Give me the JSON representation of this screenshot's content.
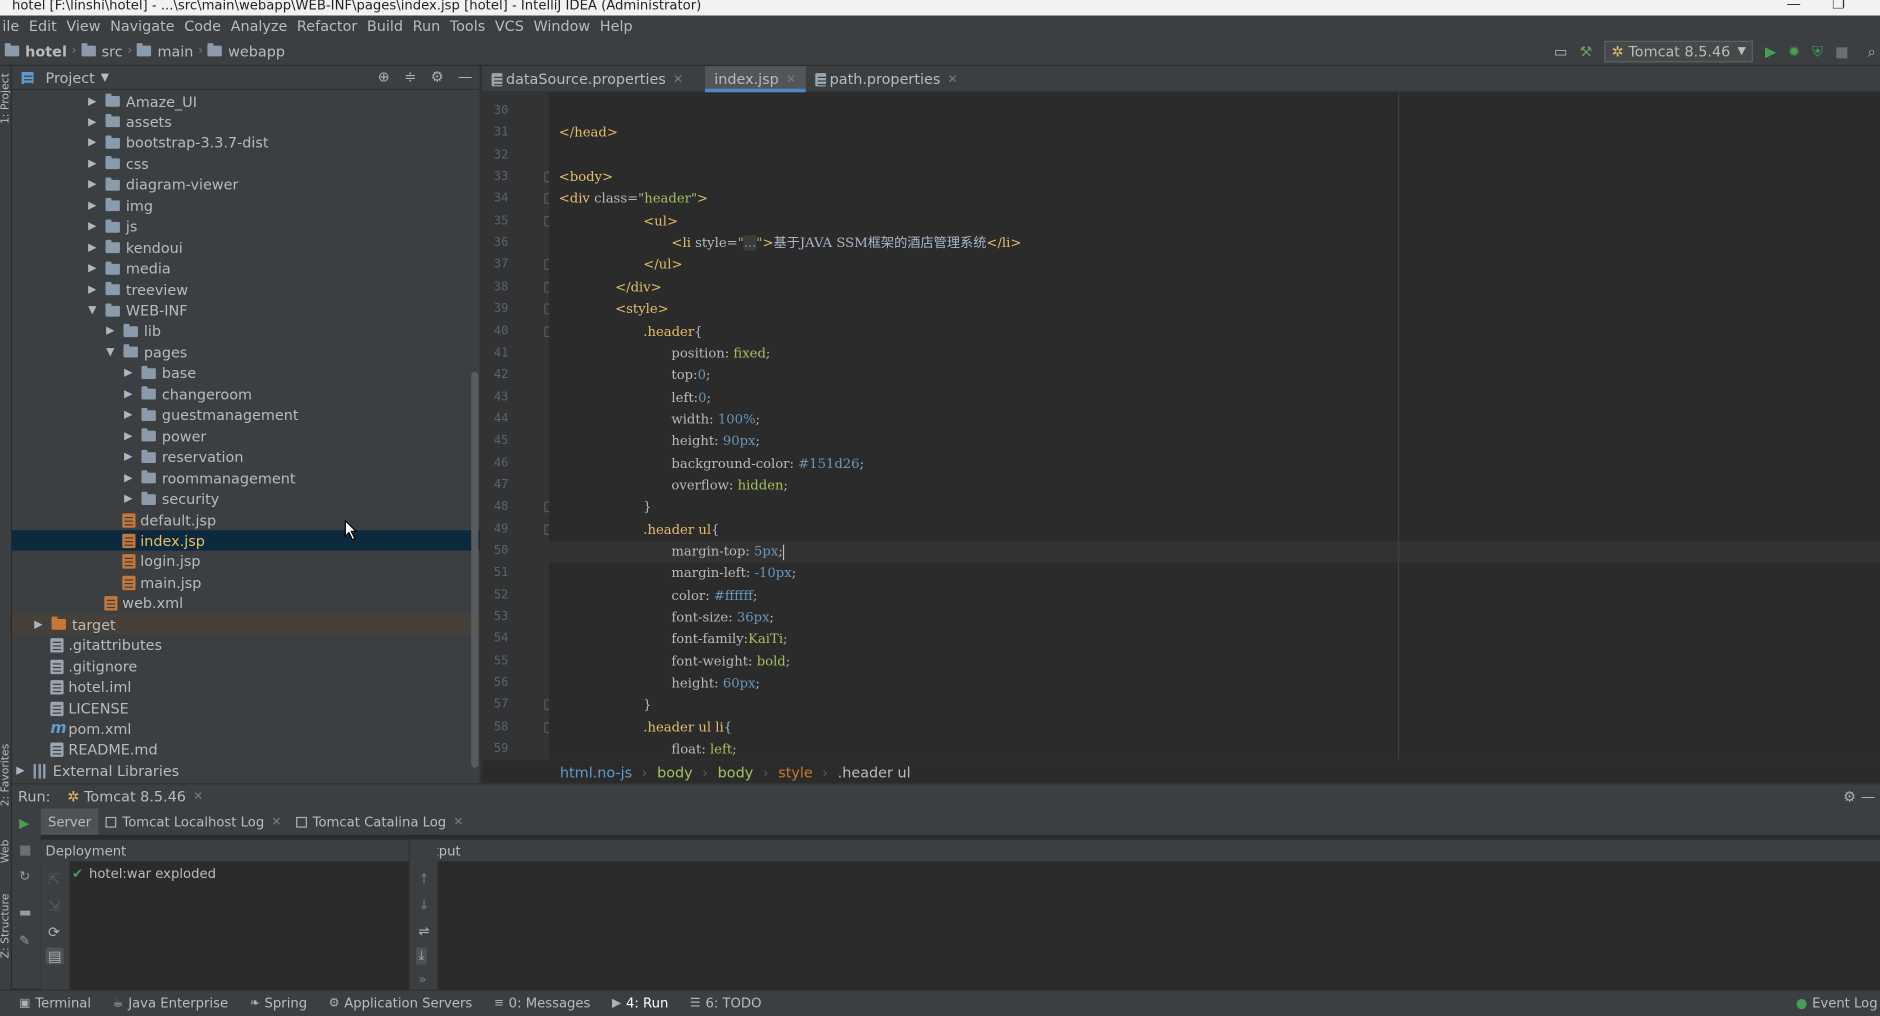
{
  "window_title": "hotel [F:\\linshi\\hotel] - ...\\src\\main\\webapp\\WEB-INF\\pages\\index.jsp [hotel] - IntelliJ IDEA (Administrator)",
  "menu": [
    "ile",
    "Edit",
    "View",
    "Navigate",
    "Code",
    "Analyze",
    "Refactor",
    "Build",
    "Run",
    "Tools",
    "VCS",
    "Window",
    "Help"
  ],
  "breadcrumb": [
    "hotel",
    "src",
    "main",
    "webapp"
  ],
  "run_config": "Tomcat 8.5.46",
  "left_tool_labels": [
    "1: Project",
    "2: Favorites",
    "Web",
    "Z: Structure"
  ],
  "project_panel": {
    "title": "Project"
  },
  "tree": [
    {
      "label": "Amaze_UI",
      "type": "folder",
      "depth": 0,
      "arrow": "▶"
    },
    {
      "label": "assets",
      "type": "folder",
      "depth": 0,
      "arrow": "▶"
    },
    {
      "label": "bootstrap-3.3.7-dist",
      "type": "folder",
      "depth": 0,
      "arrow": "▶"
    },
    {
      "label": "css",
      "type": "folder",
      "depth": 0,
      "arrow": "▶"
    },
    {
      "label": "diagram-viewer",
      "type": "folder",
      "depth": 0,
      "arrow": "▶"
    },
    {
      "label": "img",
      "type": "folder",
      "depth": 0,
      "arrow": "▶"
    },
    {
      "label": "js",
      "type": "folder",
      "depth": 0,
      "arrow": "▶"
    },
    {
      "label": "kendoui",
      "type": "folder",
      "depth": 0,
      "arrow": "▶"
    },
    {
      "label": "media",
      "type": "folder",
      "depth": 0,
      "arrow": "▶"
    },
    {
      "label": "treeview",
      "type": "folder",
      "depth": 0,
      "arrow": "▶"
    },
    {
      "label": "WEB-INF",
      "type": "folder",
      "depth": 0,
      "arrow": "▼"
    },
    {
      "label": "lib",
      "type": "folder",
      "depth": 1,
      "arrow": "▶"
    },
    {
      "label": "pages",
      "type": "folder",
      "depth": 1,
      "arrow": "▼"
    },
    {
      "label": "base",
      "type": "folder",
      "depth": 2,
      "arrow": "▶"
    },
    {
      "label": "changeroom",
      "type": "folder",
      "depth": 2,
      "arrow": "▶"
    },
    {
      "label": "guestmanagement",
      "type": "folder",
      "depth": 2,
      "arrow": "▶"
    },
    {
      "label": "power",
      "type": "folder",
      "depth": 2,
      "arrow": "▶"
    },
    {
      "label": "reservation",
      "type": "folder",
      "depth": 2,
      "arrow": "▶"
    },
    {
      "label": "roommanagement",
      "type": "folder",
      "depth": 2,
      "arrow": "▶"
    },
    {
      "label": "security",
      "type": "folder",
      "depth": 2,
      "arrow": "▶"
    },
    {
      "label": "default.jsp",
      "type": "jsp",
      "depth": 2,
      "arrow": ""
    },
    {
      "label": "index.jsp",
      "type": "jsp",
      "depth": 2,
      "arrow": "",
      "selected": true
    },
    {
      "label": "login.jsp",
      "type": "jsp",
      "depth": 2,
      "arrow": ""
    },
    {
      "label": "main.jsp",
      "type": "jsp",
      "depth": 2,
      "arrow": ""
    },
    {
      "label": "web.xml",
      "type": "jsp",
      "depth": 1,
      "arrow": ""
    },
    {
      "label": "target",
      "type": "folder-orange",
      "depth": -3,
      "arrow": "▶",
      "highlight": true
    },
    {
      "label": ".gitattributes",
      "type": "txt",
      "depth": -2,
      "arrow": ""
    },
    {
      "label": ".gitignore",
      "type": "txt",
      "depth": -2,
      "arrow": ""
    },
    {
      "label": "hotel.iml",
      "type": "txt",
      "depth": -2,
      "arrow": ""
    },
    {
      "label": "LICENSE",
      "type": "txt",
      "depth": -2,
      "arrow": ""
    },
    {
      "label": "pom.xml",
      "type": "m",
      "depth": -2,
      "arrow": ""
    },
    {
      "label": "README.md",
      "type": "txt",
      "depth": -2,
      "arrow": ""
    },
    {
      "label": "External Libraries",
      "type": "lib",
      "depth": -4,
      "arrow": "▶"
    }
  ],
  "tabs": [
    {
      "label": "dataSource.properties",
      "active": false
    },
    {
      "label": "index.jsp",
      "active": true
    },
    {
      "label": "path.properties",
      "active": false
    }
  ],
  "code_lines": [
    {
      "n": "30",
      "segs": []
    },
    {
      "n": "31",
      "segs": [
        [
          "tag",
          "</head>"
        ]
      ],
      "indent": 0
    },
    {
      "n": "32",
      "segs": []
    },
    {
      "n": "33",
      "segs": [
        [
          "tag",
          "<body>"
        ]
      ],
      "indent": 0
    },
    {
      "n": "34",
      "segs": [
        [
          "tag",
          "<div "
        ],
        [
          "attr",
          "class="
        ],
        [
          "str",
          "\"header\""
        ],
        [
          "tag",
          ">"
        ]
      ],
      "indent": 0
    },
    {
      "n": "35",
      "segs": [
        [
          "tag",
          "<ul>"
        ]
      ],
      "indent": 3
    },
    {
      "n": "36",
      "segs": [
        [
          "tag",
          "<li "
        ],
        [
          "attr",
          "style="
        ],
        [
          "str",
          "\""
        ],
        [
          "fold-ell",
          "..."
        ],
        [
          "str",
          "\""
        ],
        [
          "tag",
          ">"
        ],
        [
          "plain",
          "基于JAVA SSM框架的酒店管理系统"
        ],
        [
          "tag",
          "</li>"
        ]
      ],
      "indent": 4
    },
    {
      "n": "37",
      "segs": [
        [
          "tag",
          "</ul>"
        ]
      ],
      "indent": 3
    },
    {
      "n": "38",
      "segs": [
        [
          "tag",
          "</div>"
        ]
      ],
      "indent": 2
    },
    {
      "n": "39",
      "segs": [
        [
          "tag",
          "<style>"
        ]
      ],
      "indent": 2
    },
    {
      "n": "40",
      "segs": [
        [
          "sel",
          ".header"
        ],
        [
          "plain",
          "{"
        ]
      ],
      "indent": 3
    },
    {
      "n": "41",
      "segs": [
        [
          "prop",
          "position: "
        ],
        [
          "val",
          "fixed"
        ],
        [
          "plain",
          ";"
        ]
      ],
      "indent": 4
    },
    {
      "n": "42",
      "segs": [
        [
          "prop",
          "top:"
        ],
        [
          "num",
          "0"
        ],
        [
          "plain",
          ";"
        ]
      ],
      "indent": 4
    },
    {
      "n": "43",
      "segs": [
        [
          "prop",
          "left:"
        ],
        [
          "num",
          "0"
        ],
        [
          "plain",
          ";"
        ]
      ],
      "indent": 4
    },
    {
      "n": "44",
      "segs": [
        [
          "prop",
          "width: "
        ],
        [
          "num",
          "100%"
        ],
        [
          "plain",
          ";"
        ]
      ],
      "indent": 4
    },
    {
      "n": "45",
      "segs": [
        [
          "prop",
          "height: "
        ],
        [
          "num",
          "90px"
        ],
        [
          "plain",
          ";"
        ]
      ],
      "indent": 4
    },
    {
      "n": "46",
      "segs": [
        [
          "prop",
          "background-color: "
        ],
        [
          "hex",
          "#151d26"
        ],
        [
          "plain",
          ";"
        ]
      ],
      "indent": 4
    },
    {
      "n": "47",
      "segs": [
        [
          "prop",
          "overflow: "
        ],
        [
          "val",
          "hidden"
        ],
        [
          "plain",
          ";"
        ]
      ],
      "indent": 4
    },
    {
      "n": "48",
      "segs": [
        [
          "plain",
          "}"
        ]
      ],
      "indent": 3
    },
    {
      "n": "49",
      "segs": [
        [
          "sel",
          ".header ul"
        ],
        [
          "plain",
          "{"
        ]
      ],
      "indent": 3
    },
    {
      "n": "50",
      "segs": [
        [
          "prop",
          "margin-top: "
        ],
        [
          "num",
          "5px"
        ],
        [
          "plain",
          ";"
        ]
      ],
      "indent": 4,
      "current": true
    },
    {
      "n": "51",
      "segs": [
        [
          "prop",
          "margin-left: "
        ],
        [
          "num",
          "-10px"
        ],
        [
          "plain",
          ";"
        ]
      ],
      "indent": 4
    },
    {
      "n": "52",
      "segs": [
        [
          "prop",
          "color: "
        ],
        [
          "hex",
          "#ffffff"
        ],
        [
          "plain",
          ";"
        ]
      ],
      "indent": 4
    },
    {
      "n": "53",
      "segs": [
        [
          "prop",
          "font-size: "
        ],
        [
          "num",
          "36px"
        ],
        [
          "plain",
          ";"
        ]
      ],
      "indent": 4
    },
    {
      "n": "54",
      "segs": [
        [
          "prop",
          "font-family:"
        ],
        [
          "val",
          "KaiTi"
        ],
        [
          "plain",
          ";"
        ]
      ],
      "indent": 4
    },
    {
      "n": "55",
      "segs": [
        [
          "prop",
          "font-weight: "
        ],
        [
          "val",
          "bold"
        ],
        [
          "plain",
          ";"
        ]
      ],
      "indent": 4
    },
    {
      "n": "56",
      "segs": [
        [
          "prop",
          "height: "
        ],
        [
          "num",
          "60px"
        ],
        [
          "plain",
          ";"
        ]
      ],
      "indent": 4
    },
    {
      "n": "57",
      "segs": [
        [
          "plain",
          "}"
        ]
      ],
      "indent": 3
    },
    {
      "n": "58",
      "segs": [
        [
          "sel",
          ".header ul li"
        ],
        [
          "plain",
          "{"
        ]
      ],
      "indent": 3
    },
    {
      "n": "59",
      "segs": [
        [
          "prop",
          "float: "
        ],
        [
          "val",
          "left"
        ],
        [
          "plain",
          ";"
        ]
      ],
      "indent": 4
    }
  ],
  "editor_crumbs": [
    {
      "label": "html.no-js",
      "color": "#5c9ccc"
    },
    {
      "label": "body",
      "color": "#a5c25c"
    },
    {
      "label": "body",
      "color": "#a5c25c"
    },
    {
      "label": "style",
      "color": "#cc7832"
    },
    {
      "label": ".header ul",
      "color": "#bbbbbb"
    }
  ],
  "run_panel": {
    "label": "Run:",
    "tab": "Tomcat 8.5.46",
    "subtabs": [
      "Server",
      "Tomcat Localhost Log",
      "Tomcat Catalina Log"
    ],
    "deployment_header": "Deployment",
    "output_header": "Output",
    "deployment_item": "hotel:war exploded"
  },
  "status_tools": [
    {
      "label": "Terminal",
      "icon": "▣"
    },
    {
      "label": "Java Enterprise",
      "icon": "☕"
    },
    {
      "label": "Spring",
      "icon": "❧"
    },
    {
      "label": "Application Servers",
      "icon": "⚙"
    },
    {
      "label": "0: Messages",
      "icon": "≡"
    },
    {
      "label": "4: Run",
      "icon": "▶",
      "active": true
    },
    {
      "label": "6: TODO",
      "icon": "☰"
    }
  ],
  "event_log": "Event Log"
}
